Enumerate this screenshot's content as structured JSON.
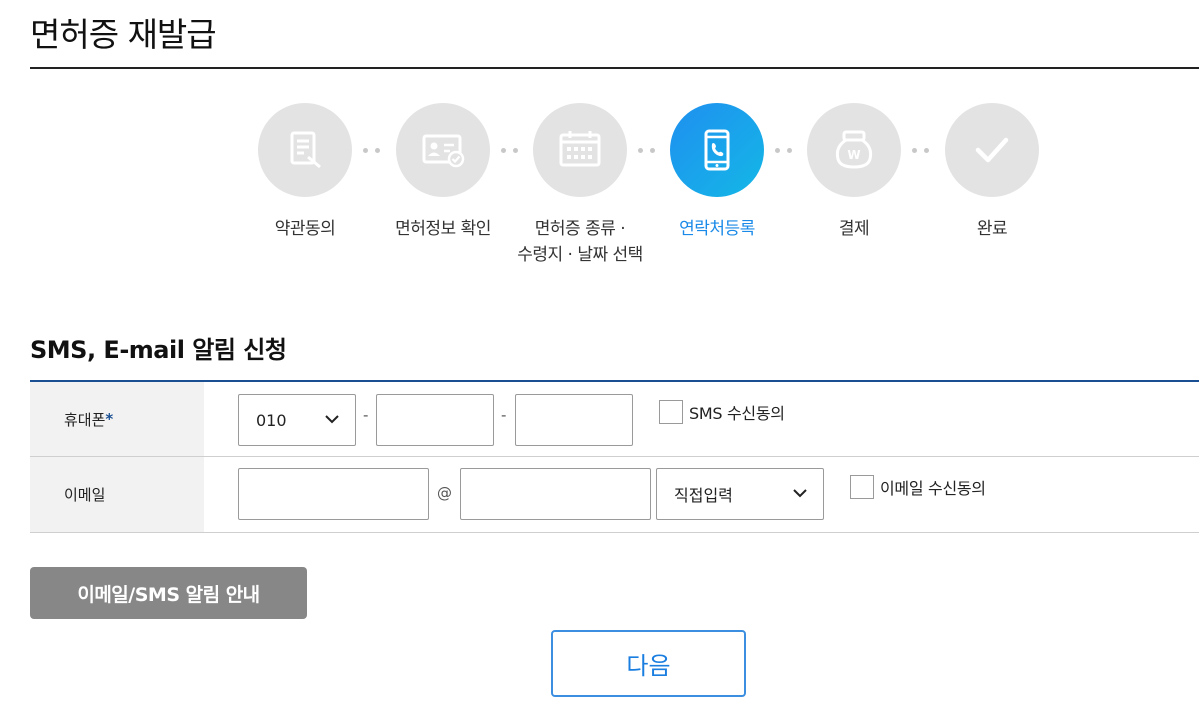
{
  "page": {
    "title": "면허증 재발급"
  },
  "steps": [
    {
      "label": "약관동의",
      "icon": "document-pen-icon",
      "active": false
    },
    {
      "label": "면허정보 확인",
      "icon": "id-card-check-icon",
      "active": false
    },
    {
      "label_line1": "면허증 종류 ·",
      "label_line2": "수령지 · 날짜 선택",
      "icon": "calendar-icon",
      "active": false
    },
    {
      "label": "연락처등록",
      "icon": "phone-icon",
      "active": true
    },
    {
      "label": "결제",
      "icon": "money-bag-icon",
      "active": false
    },
    {
      "label": "완료",
      "icon": "check-icon",
      "active": false
    }
  ],
  "section": {
    "title": "SMS, E-mail 알림 신청"
  },
  "form": {
    "phone": {
      "label": "휴대폰",
      "required_mark": "*",
      "prefix_value": "010",
      "separator": "-",
      "middle_value": "",
      "last_value": "",
      "consent_label": "SMS 수신동의"
    },
    "email": {
      "label": "이메일",
      "id_value": "",
      "at_sign": "@",
      "domain_value": "",
      "domain_select_value": "직접입력",
      "consent_label": "이메일 수신동의"
    }
  },
  "buttons": {
    "notice_label": "이메일/SMS 알림 안내",
    "next_label": "다음"
  },
  "colors": {
    "active_step": "#1a8ae8",
    "inactive_step": "#e3e3e3",
    "table_rule": "#1a4f93",
    "notice_button": "#878787",
    "next_border": "#3c8ee0"
  }
}
